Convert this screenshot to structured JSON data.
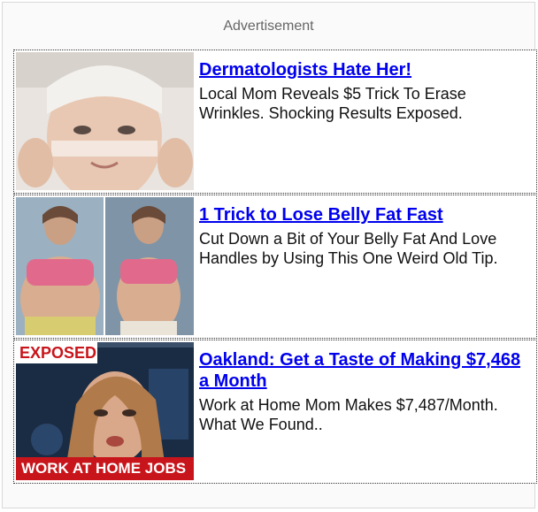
{
  "header": {
    "label": "Advertisement"
  },
  "ads": [
    {
      "headline": "Dermatologists Hate Her!",
      "description": "Local Mom Reveals $5 Trick To Erase Wrinkles. Shocking Results Exposed."
    },
    {
      "headline": "1 Trick to Lose Belly Fat Fast",
      "description": "Cut Down a Bit of Your Belly Fat And Love Handles by Using This One Weird Old Tip."
    },
    {
      "headline": "Oakland: Get a Taste of Making $7,468 a Month",
      "description": "Work at Home Mom Makes $7,487/Month. What We Found..",
      "thumb_top_text": "EXPOSED",
      "thumb_bottom_text": "WORK AT HOME JOBS"
    }
  ],
  "colors": {
    "link": "#0000ee",
    "badge_red": "#c8151b",
    "header_text": "#666666"
  }
}
